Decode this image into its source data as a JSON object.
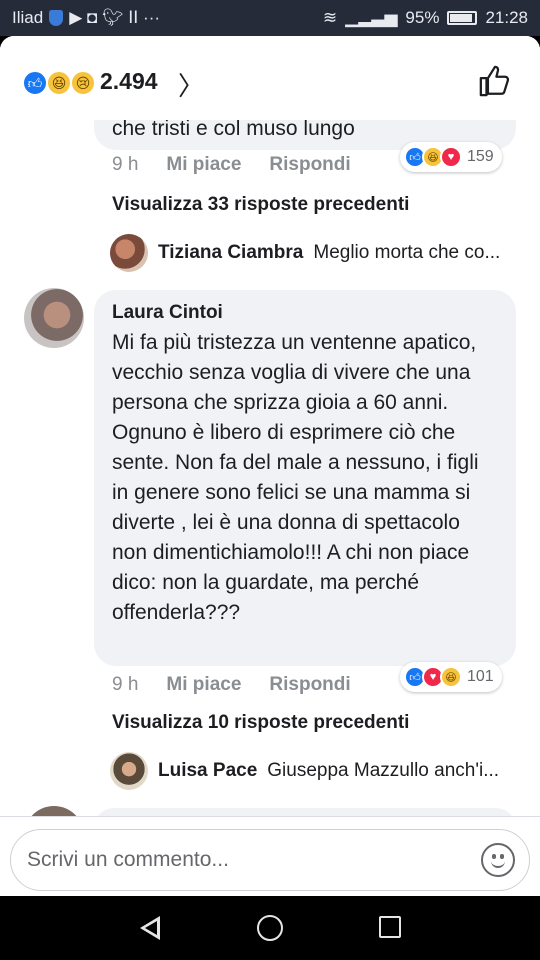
{
  "status_bar": {
    "carrier": "Iliad",
    "battery": "95%",
    "time": "21:28"
  },
  "header": {
    "reaction_count": "2.494",
    "reactions": [
      "like",
      "haha",
      "sad"
    ]
  },
  "comments": [
    {
      "partial_text": "che tristi e col muso lungo",
      "time": "9 h",
      "like_label": "Mi piace",
      "reply_label": "Rispondi",
      "reaction_count": "159",
      "reactions": [
        "like",
        "haha",
        "love"
      ],
      "view_previous": "Visualizza 33 risposte precedenti",
      "latest_reply": {
        "name": "Tiziana Ciambra",
        "snippet": "Meglio morta che co..."
      }
    },
    {
      "author": "Laura Cintoi",
      "text": "Mi fa più tristezza un ventenne apatico, vecchio senza voglia di vivere che una persona che sprizza gioia a 60 anni. Ognuno è libero di esprimere ciò che sente. Non fa del male a nessuno, i figli in genere sono felici se una mamma si diverte , lei è una donna di spettacolo non dimentichiamolo!!! A chi non piace dico: non la guardate, ma perché offenderla???",
      "time": "9 h",
      "like_label": "Mi piace",
      "reply_label": "Rispondi",
      "reaction_count": "101",
      "reactions": [
        "like",
        "love",
        "haha"
      ],
      "view_previous": "Visualizza 10 risposte precedenti",
      "latest_reply": {
        "name": "Luisa Pace",
        "snippet": "Giuseppa Mazzullo anch'i..."
      }
    }
  ],
  "composer": {
    "placeholder": "Scrivi un commento..."
  },
  "colors": {
    "facebook_blue": "#1877f2",
    "love_red": "#f02849",
    "haha_yellow": "#f7c33a",
    "bubble_gray": "#f0f2f5"
  }
}
